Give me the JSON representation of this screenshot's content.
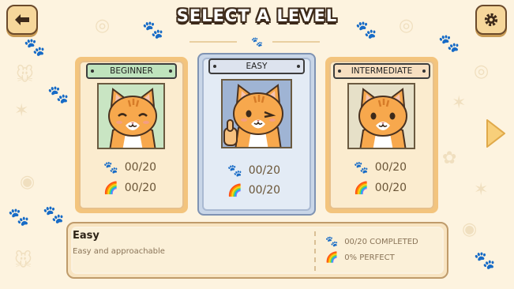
{
  "header": {
    "title": "SELECT A LEVEL",
    "back_icon": "arrow-left-icon",
    "settings_icon": "gear-icon"
  },
  "levels": [
    {
      "label": "BEGINNER",
      "paw_progress": "00/20",
      "rainbow_progress": "00/20",
      "pose": "happy-closed-eyes",
      "label_color": "#bfe3bd",
      "selected": false
    },
    {
      "label": "EASY",
      "paw_progress": "00/20",
      "rainbow_progress": "00/20",
      "pose": "thumbs-up-wink",
      "label_color": "#dde3ee",
      "selected": true
    },
    {
      "label": "INTERMEDIATE",
      "paw_progress": "00/20",
      "rainbow_progress": "00/20",
      "pose": "neutral",
      "label_color": "#f7dfc1",
      "selected": false
    }
  ],
  "details": {
    "name": "Easy",
    "description": "Easy and approachable",
    "completed": "00/20 COMPLETED",
    "perfect": "0% PERFECT"
  },
  "nav": {
    "next_icon": "chevron-right-icon"
  },
  "colors": {
    "background": "#fdf3df",
    "card_orange": "#f3c47d",
    "card_blue": "#c9d6e8",
    "cat_orange": "#f5a54a",
    "text_brown": "#6b5638"
  }
}
